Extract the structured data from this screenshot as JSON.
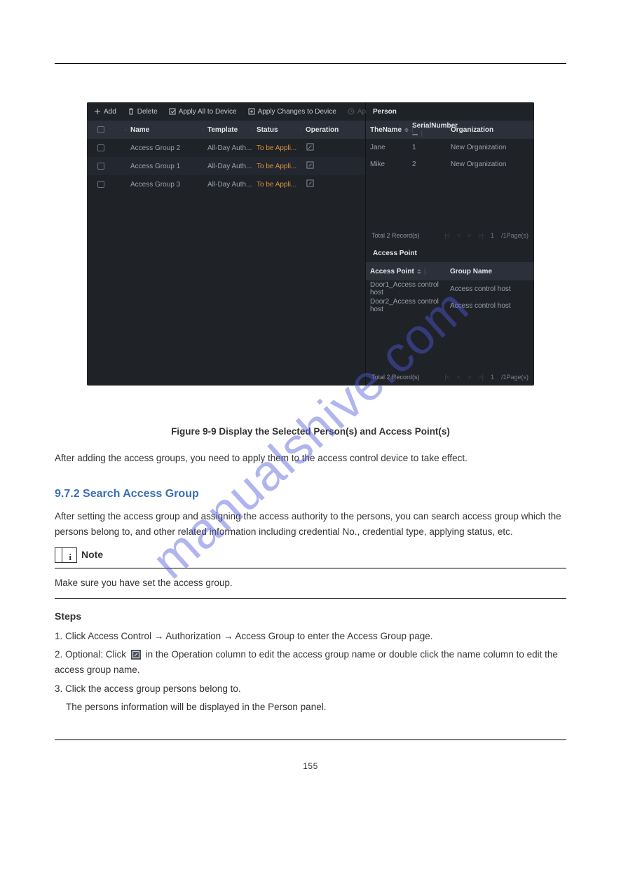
{
  "watermark": "manualshive.com",
  "header_rule_title": "",
  "screenshot": {
    "toolbar": {
      "add": "Add",
      "delete": "Delete",
      "apply_all": "Apply All to Device",
      "apply_changes": "Apply Changes to Device",
      "applying_status": "Applying Status"
    },
    "left_table": {
      "headers": {
        "name": "Name",
        "template": "Template",
        "status": "Status",
        "operation": "Operation"
      },
      "rows": [
        {
          "name": "Access Group 2",
          "template": "All-Day Auth...",
          "status": "To be Appli..."
        },
        {
          "name": "Access Group 1",
          "template": "All-Day Auth...",
          "status": "To be Appli..."
        },
        {
          "name": "Access Group 3",
          "template": "All-Day Auth...",
          "status": "To be Appli..."
        }
      ]
    },
    "person": {
      "title": "Person",
      "headers": {
        "name": "TheName",
        "serial": "SerialNumber ...",
        "org": "Organization"
      },
      "rows": [
        {
          "name": "Jane",
          "serial": "1",
          "org": "New Organization"
        },
        {
          "name": "Mike",
          "serial": "2",
          "org": "New Organization"
        }
      ],
      "pager": {
        "total": "Total 2 Record(s)",
        "page_of": "/1Page(s)",
        "cur": "1"
      }
    },
    "access_point": {
      "title": "Access Point",
      "headers": {
        "ap": "Access Point",
        "group": "Group Name"
      },
      "rows": [
        {
          "ap": "Door1_Access control host",
          "group": "Access control host"
        },
        {
          "ap": "Door2_Access control host",
          "group": "Access control host"
        }
      ],
      "pager": {
        "total": "Total 2 Record(s)",
        "page_of": "/1Page(s)",
        "cur": "1"
      }
    }
  },
  "caption": "Figure 9-9 Display the Selected Person(s) and Access Point(s)",
  "para_after": "After adding the access groups, you need to apply them to the access control device to take effect.",
  "section_title": "9.7.2 Search Access Group",
  "section_para": "After setting the access group and assigning the access authority to the persons, you can search access group which the persons belong to, and other related information including credential No., credential type, applying status, etc.",
  "note_label": "Note",
  "note_text": "Make sure you have set the access group.",
  "steps_label": "Steps",
  "step1_text": "1. Click Access Control → Authorization → Access Group to enter the Access Group page.",
  "step2_prefix": "2. Optional: Click",
  "step2_suffix": "in the Operation column to edit the access group name or double click the name column to edit the access group name.",
  "step3_text": "3. Click the access group persons belong to.",
  "step3_sub": "The persons information will be displayed in the Person panel.",
  "page_num": "155"
}
